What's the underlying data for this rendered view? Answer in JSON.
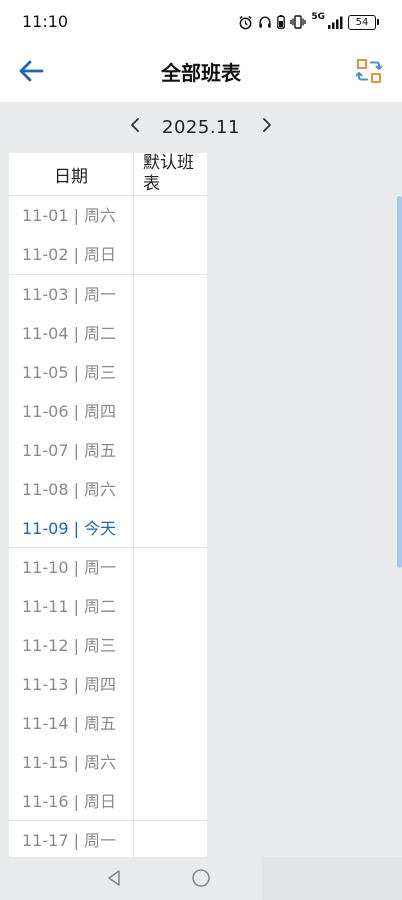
{
  "status_bar": {
    "time": "11:10",
    "network": "5G",
    "battery": "54",
    "icons": [
      "alarm-icon",
      "headphones-icon",
      "headphone-battery-icon",
      "vibrate-icon",
      "signal-icon",
      "battery-icon"
    ]
  },
  "nav": {
    "title": "全部班表",
    "back_icon": "arrow-left-icon",
    "action_icon": "switch-schedule-icon"
  },
  "month": {
    "label": "2025.11",
    "prev_icon": "chevron-left-icon",
    "next_icon": "chevron-right-icon"
  },
  "table": {
    "headers": {
      "date": "日期",
      "shift": "默认班表"
    },
    "groups": [
      {
        "rows": [
          {
            "date": "11-01 | 周六"
          },
          {
            "date": "11-02 | 周日"
          }
        ]
      },
      {
        "rows": [
          {
            "date": "11-03 | 周一"
          },
          {
            "date": "11-04 | 周二"
          },
          {
            "date": "11-05 | 周三"
          },
          {
            "date": "11-06 | 周四"
          },
          {
            "date": "11-07 | 周五"
          },
          {
            "date": "11-08 | 周六"
          },
          {
            "date": "11-09 | 今天",
            "today": true
          }
        ]
      },
      {
        "rows": [
          {
            "date": "11-10 | 周一"
          },
          {
            "date": "11-11 | 周二"
          },
          {
            "date": "11-12 | 周三"
          },
          {
            "date": "11-13 | 周四"
          },
          {
            "date": "11-14 | 周五"
          },
          {
            "date": "11-15 | 周六"
          },
          {
            "date": "11-16 | 周日"
          }
        ]
      },
      {
        "rows": [
          {
            "date": "11-17 | 周一"
          }
        ]
      }
    ]
  },
  "colors": {
    "accent": "#1b66b6",
    "muted_text": "#8a8a8a",
    "background": "#e9eaec",
    "divider": "#e3e4e6"
  },
  "bottom_nav": {
    "icons": [
      "nav-back-icon",
      "nav-home-icon"
    ]
  }
}
